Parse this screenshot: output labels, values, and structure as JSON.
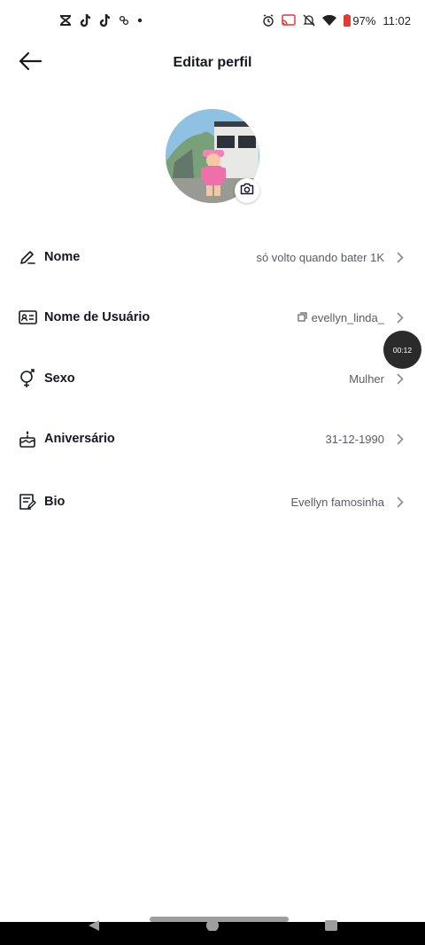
{
  "status_bar": {
    "battery": "97%",
    "time": "11:02",
    "left_icons": [
      "capcut-icon",
      "tiktok-icon",
      "tiktok-icon",
      "threads-icon",
      "dot-icon"
    ],
    "right_icons": [
      "alarm-icon",
      "cast-icon",
      "mute-icon",
      "wifi-icon",
      "battery-icon"
    ]
  },
  "header": {
    "title": "Editar perfil",
    "back_icon": "arrow-left-icon"
  },
  "avatar": {
    "camera_icon": "camera-icon"
  },
  "fields": [
    {
      "label": "Nome",
      "value": "só volto quando bater 1K",
      "icon": "pencil-icon"
    },
    {
      "label": "Nome de Usuário",
      "value": "evellyn_linda_",
      "icon": "id-card-icon",
      "value_icon": "copy-icon"
    },
    {
      "label": "Sexo",
      "value": "Mulher",
      "icon": "gender-icon"
    },
    {
      "label": "Aniversário",
      "value": "31-12-1990",
      "icon": "cake-icon"
    },
    {
      "label": "Bio",
      "value": "Evellyn famosinha",
      "icon": "note-edit-icon"
    }
  ],
  "timer_bubble": "00:12",
  "colors": {
    "text_primary": "#161823",
    "text_secondary": "#5a5c63",
    "chevron": "#8a8b91",
    "timer_bg": "#2b2b2b"
  }
}
